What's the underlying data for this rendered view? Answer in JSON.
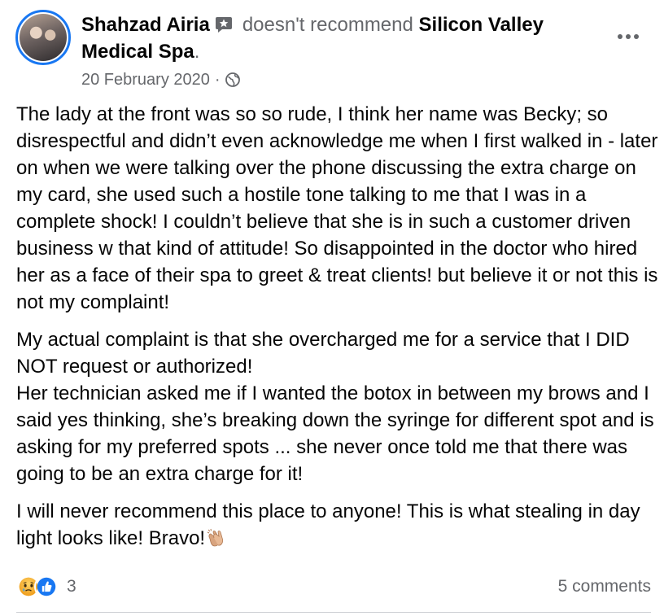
{
  "post": {
    "author": "Shahzad Airia",
    "recommendation_text": "doesn't recommend",
    "page_name": "Silicon Valley Medical Spa",
    "page_name_suffix": ".",
    "date": "20 February 2020",
    "date_separator": "·",
    "audience_icon": "globe-icon",
    "author_badge_icon": "star-badge-icon",
    "paragraphs": [
      "The lady at the front was so so rude, I think her name was Becky; so disrespectful and didn’t even acknowledge me when I first walked in - later on when we were talking over the phone discussing the extra charge on my card, she used such a hostile tone talking to me that I was in a complete shock! I couldn’t believe that she is in such a customer driven business w that kind of attitude! So disappointed in the doctor who hired her as a face of their spa to greet & treat clients! but believe it or not this is not my complaint!",
      "My actual complaint is that she overcharged me for a service that I DID NOT request or authorized!",
      "Her technician asked me if I wanted the botox in between my brows and I said yes thinking, she’s breaking down the syringe for different spot and is asking for my preferred spots ... she never once told me that there was going to be an extra charge for it!",
      "I will never recommend this place to anyone! This is what stealing in day light looks like! Bravo!"
    ],
    "closing_emoji": "clapping-hands-icon"
  },
  "footer": {
    "reaction_icons": [
      "sad-reaction-icon",
      "like-reaction-icon"
    ],
    "reaction_count": "3",
    "comments": "5 comments"
  },
  "colors": {
    "accent": "#1877f2",
    "secondary_text": "#65676b",
    "primary_text": "#050505",
    "divider": "#ced0d4"
  }
}
